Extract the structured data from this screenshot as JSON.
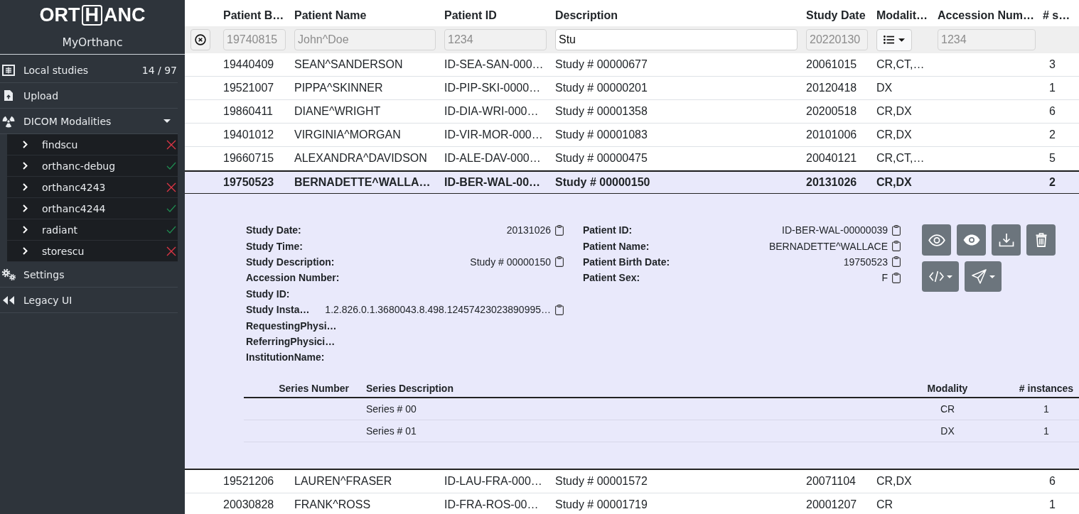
{
  "sidebar": {
    "logo": {
      "before": "ORT",
      "boxed": "H",
      "after": "ANC"
    },
    "server_name": "MyOrthanc",
    "items": [
      {
        "label": "Local studies",
        "count": "14 / 97"
      },
      {
        "label": "Upload"
      },
      {
        "label": "DICOM Modalities",
        "expanded": true,
        "children": [
          {
            "label": "findscu",
            "reachable": false
          },
          {
            "label": "orthanc-debug",
            "reachable": true
          },
          {
            "label": "orthanc4243",
            "reachable": false
          },
          {
            "label": "orthanc4244",
            "reachable": true
          },
          {
            "label": "radiant",
            "reachable": true
          },
          {
            "label": "storescu",
            "reachable": false
          }
        ]
      },
      {
        "label": "Settings"
      },
      {
        "label": "Legacy UI"
      }
    ]
  },
  "table": {
    "columns": [
      "Patient B…",
      "Patient Name",
      "Patient ID",
      "Description",
      "Study Date",
      "Modalit…",
      "Accession Num…",
      "# s…"
    ],
    "filters": [
      {
        "kind": "text",
        "placeholder": "19740815"
      },
      {
        "kind": "text",
        "placeholder": "John^Doe"
      },
      {
        "kind": "text",
        "placeholder": "1234"
      },
      {
        "kind": "text",
        "value": "Stu"
      },
      {
        "kind": "text",
        "placeholder": "20220130"
      },
      {
        "kind": "dropdown"
      },
      {
        "kind": "text",
        "placeholder": "1234"
      }
    ],
    "rows": [
      {
        "selected": false,
        "cells": [
          "19440409",
          "SEAN^SANDERSON",
          "ID-SEA-SAN-000…",
          "Study # 00000677",
          "20061015",
          "CR,CT,…",
          null,
          "3"
        ]
      },
      {
        "selected": false,
        "cells": [
          "19521007",
          "PIPPA^SKINNER",
          "ID-PIP-SKI-0000…",
          "Study # 00000201",
          "20120418",
          "DX",
          null,
          "1"
        ]
      },
      {
        "selected": false,
        "cells": [
          "19860411",
          "DIANE^WRIGHT",
          "ID-DIA-WRI-000…",
          "Study # 00001358",
          "20200518",
          "CR,DX",
          null,
          "6"
        ]
      },
      {
        "selected": false,
        "cells": [
          "19401012",
          "VIRGINIA^MORGAN",
          "ID-VIR-MOR-000…",
          "Study # 00001083",
          "20101006",
          "CR,DX",
          null,
          "2"
        ]
      },
      {
        "selected": false,
        "cells": [
          "19660715",
          "ALEXANDRA^DAVIDSON",
          "ID-ALE-DAV-000…",
          "Study # 00000475",
          "20040121",
          "CR,CT,…",
          null,
          "5"
        ]
      },
      {
        "selected": true,
        "cells": [
          "19750523",
          "BERNADETTE^WALLA…",
          "ID-BER-WAL-00…",
          "Study # 00000150",
          "20131026",
          "CR,DX",
          null,
          "2"
        ],
        "details": {
          "study_fields": [
            {
              "label": "Study Date:",
              "value": "20131026"
            },
            {
              "label": "Study Time:"
            },
            {
              "label": "Study Description:",
              "value": "Study # 00000150"
            },
            {
              "label": "Accession Number:"
            },
            {
              "label": "Study ID:"
            },
            {
              "label": "Study Insta…",
              "value": "1.2.826.0.1.3680043.8.498.12457423023890995…"
            },
            {
              "label": "RequestingPhysi…"
            },
            {
              "label": "ReferringPhysici…"
            },
            {
              "label": "InstitutionName:"
            }
          ],
          "patient_fields": [
            {
              "label": "Patient ID:",
              "value": "ID-BER-WAL-00000039"
            },
            {
              "label": "Patient Name:",
              "value": "BERNADETTE^WALLACE"
            },
            {
              "label": "Patient Birth Date:",
              "value": "19750523"
            },
            {
              "label": "Patient Sex:",
              "value": "F"
            }
          ],
          "series": {
            "columns": [
              "Series Number",
              "Series Description",
              "Modality",
              "# instances"
            ],
            "rows": [
              {
                "cells": [
                  null,
                  "Series # 00",
                  "CR",
                  "1"
                ]
              },
              {
                "cells": [
                  null,
                  "Series # 01",
                  "DX",
                  "1"
                ]
              }
            ]
          }
        }
      },
      {
        "selected": false,
        "cells": [
          "19521206",
          "LAUREN^FRASER",
          "ID-LAU-FRA-000…",
          "Study # 00001572",
          "20071104",
          "CR,DX",
          null,
          "6"
        ]
      },
      {
        "selected": false,
        "cells": [
          "20030828",
          "FRANK^ROSS",
          "ID-FRA-ROS-00…",
          "Study # 00001719",
          "20001207",
          "CR",
          null,
          "1"
        ]
      }
    ]
  }
}
